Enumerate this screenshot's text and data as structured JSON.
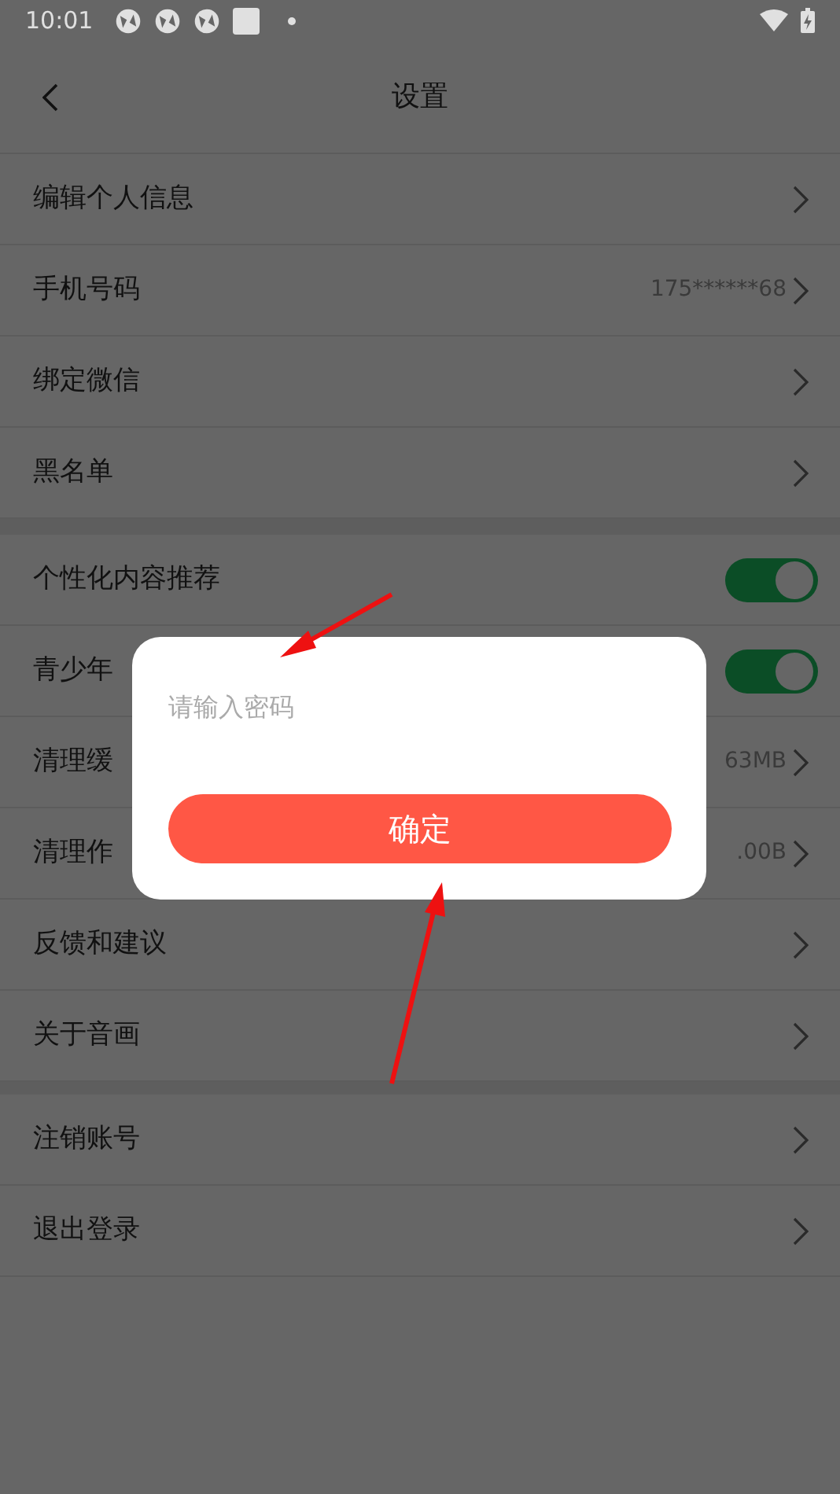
{
  "status_bar": {
    "time": "10:01"
  },
  "header": {
    "title": "设置"
  },
  "groups": [
    {
      "items": [
        {
          "kind": "link",
          "label": "编辑个人信息"
        },
        {
          "kind": "link",
          "label": "手机号码",
          "value": "175******68"
        },
        {
          "kind": "link",
          "label": "绑定微信"
        },
        {
          "kind": "link",
          "label": "黑名单"
        }
      ]
    },
    {
      "items": [
        {
          "kind": "toggle",
          "label": "个性化内容推荐",
          "on": true
        },
        {
          "kind": "toggle",
          "label": "青少年",
          "on": true
        },
        {
          "kind": "link",
          "label": "清理缓",
          "value": "63MB"
        },
        {
          "kind": "link",
          "label": "清理作",
          "value": ".00B"
        },
        {
          "kind": "link",
          "label": "反馈和建议"
        },
        {
          "kind": "link",
          "label": "关于音画"
        }
      ]
    },
    {
      "items": [
        {
          "kind": "link",
          "label": "注销账号"
        },
        {
          "kind": "link",
          "label": "退出登录"
        }
      ]
    }
  ],
  "dialog": {
    "placeholder": "请输入密码",
    "button": "确定"
  }
}
